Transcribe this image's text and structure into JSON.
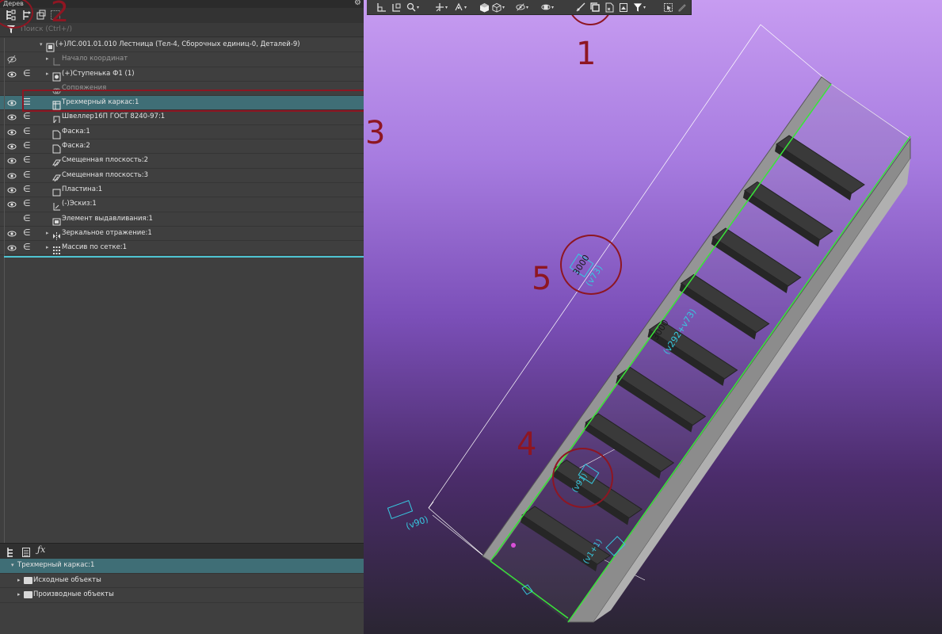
{
  "left_panel": {
    "title": "Дерев",
    "search_placeholder": "Поиск (Ctrl+/)",
    "tree_rows": [
      {
        "label": "(+)ЛС.001.01.010 Лестница (Тел-4, Сборочных единиц-0, Деталей-9)",
        "eye": false,
        "inc": false,
        "arrow": "▾",
        "indent": 52,
        "icon": "assembly-icon",
        "dim": false,
        "sel": false
      },
      {
        "label": "Начало координат",
        "eye": "hidden",
        "inc": false,
        "arrow": "▸",
        "indent": 60,
        "icon": "origin-icon",
        "dim": true,
        "sel": false
      },
      {
        "label": "(+)Ступенька Ф1 (1)",
        "eye": true,
        "inc": true,
        "arrow": "▸",
        "indent": 60,
        "icon": "part-icon",
        "dim": false,
        "sel": false
      },
      {
        "label": "Сопряжения",
        "eye": false,
        "inc": false,
        "arrow": "",
        "indent": 60,
        "icon": "mates-icon",
        "dim": true,
        "sel": false
      },
      {
        "label": "Трехмерный каркас:1",
        "eye": true,
        "inc": "bars",
        "arrow": "",
        "indent": 60,
        "icon": "frame-icon",
        "dim": false,
        "sel": true
      },
      {
        "label": "Швеллер16П ГОСТ 8240-97:1",
        "eye": true,
        "inc": true,
        "arrow": "",
        "indent": 60,
        "icon": "channel-icon",
        "dim": false,
        "sel": false
      },
      {
        "label": "Фаска:1",
        "eye": true,
        "inc": true,
        "arrow": "",
        "indent": 60,
        "icon": "chamfer-icon",
        "dim": false,
        "sel": false
      },
      {
        "label": "Фаска:2",
        "eye": true,
        "inc": true,
        "arrow": "",
        "indent": 60,
        "icon": "chamfer-icon",
        "dim": false,
        "sel": false
      },
      {
        "label": "Смещенная плоскость:2",
        "eye": true,
        "inc": true,
        "arrow": "",
        "indent": 60,
        "icon": "plane-icon",
        "dim": false,
        "sel": false
      },
      {
        "label": "Смещенная плоскость:3",
        "eye": true,
        "inc": true,
        "arrow": "",
        "indent": 60,
        "icon": "plane-icon",
        "dim": false,
        "sel": false
      },
      {
        "label": "Пластина:1",
        "eye": true,
        "inc": true,
        "arrow": "",
        "indent": 60,
        "icon": "plate-icon",
        "dim": false,
        "sel": false
      },
      {
        "label": "(-)Эскиз:1",
        "eye": true,
        "inc": true,
        "arrow": "",
        "indent": 60,
        "icon": "sketch-icon",
        "dim": false,
        "sel": false
      },
      {
        "label": "Элемент выдавливания:1",
        "eye": false,
        "inc": true,
        "arrow": "",
        "indent": 60,
        "icon": "extrude-icon",
        "dim": false,
        "sel": false
      },
      {
        "label": "Зеркальное отражение:1",
        "eye": true,
        "inc": true,
        "arrow": "▸",
        "indent": 60,
        "icon": "mirror-icon",
        "dim": false,
        "sel": false
      },
      {
        "label": "Массив по сетке:1",
        "eye": true,
        "inc": true,
        "arrow": "▸",
        "indent": 60,
        "icon": "pattern-icon",
        "dim": false,
        "sel": false
      }
    ],
    "bottom_rows": [
      {
        "label": "Трехмерный каркас:1",
        "arrow": "▾",
        "indent": 14,
        "sel": true,
        "folder": false
      },
      {
        "label": "Исходные объекты",
        "arrow": "▸",
        "indent": 22,
        "sel": false,
        "folder": true
      },
      {
        "label": "Производные объекты",
        "arrow": "▸",
        "indent": 22,
        "sel": false,
        "folder": true
      }
    ]
  },
  "annotations": {
    "n1": "1",
    "n2": "2",
    "n3": "3",
    "n4": "4",
    "n5": "5"
  },
  "viewport": {
    "dim_3000_a": "3000",
    "dim_v73": "(v73)",
    "dim_3000_b": "3000",
    "dim_v292": "(v292+v73)",
    "dim_v90": "(v90)",
    "dim_v91": "(v91)",
    "dim_v1": "(v1+1)",
    "colors": {
      "red_annotation": "#8e1622",
      "green_edge": "#39e639",
      "cyan_dim": "#36c9e0",
      "step": "#3a3a3a",
      "frame": "#8a8a8a"
    }
  }
}
